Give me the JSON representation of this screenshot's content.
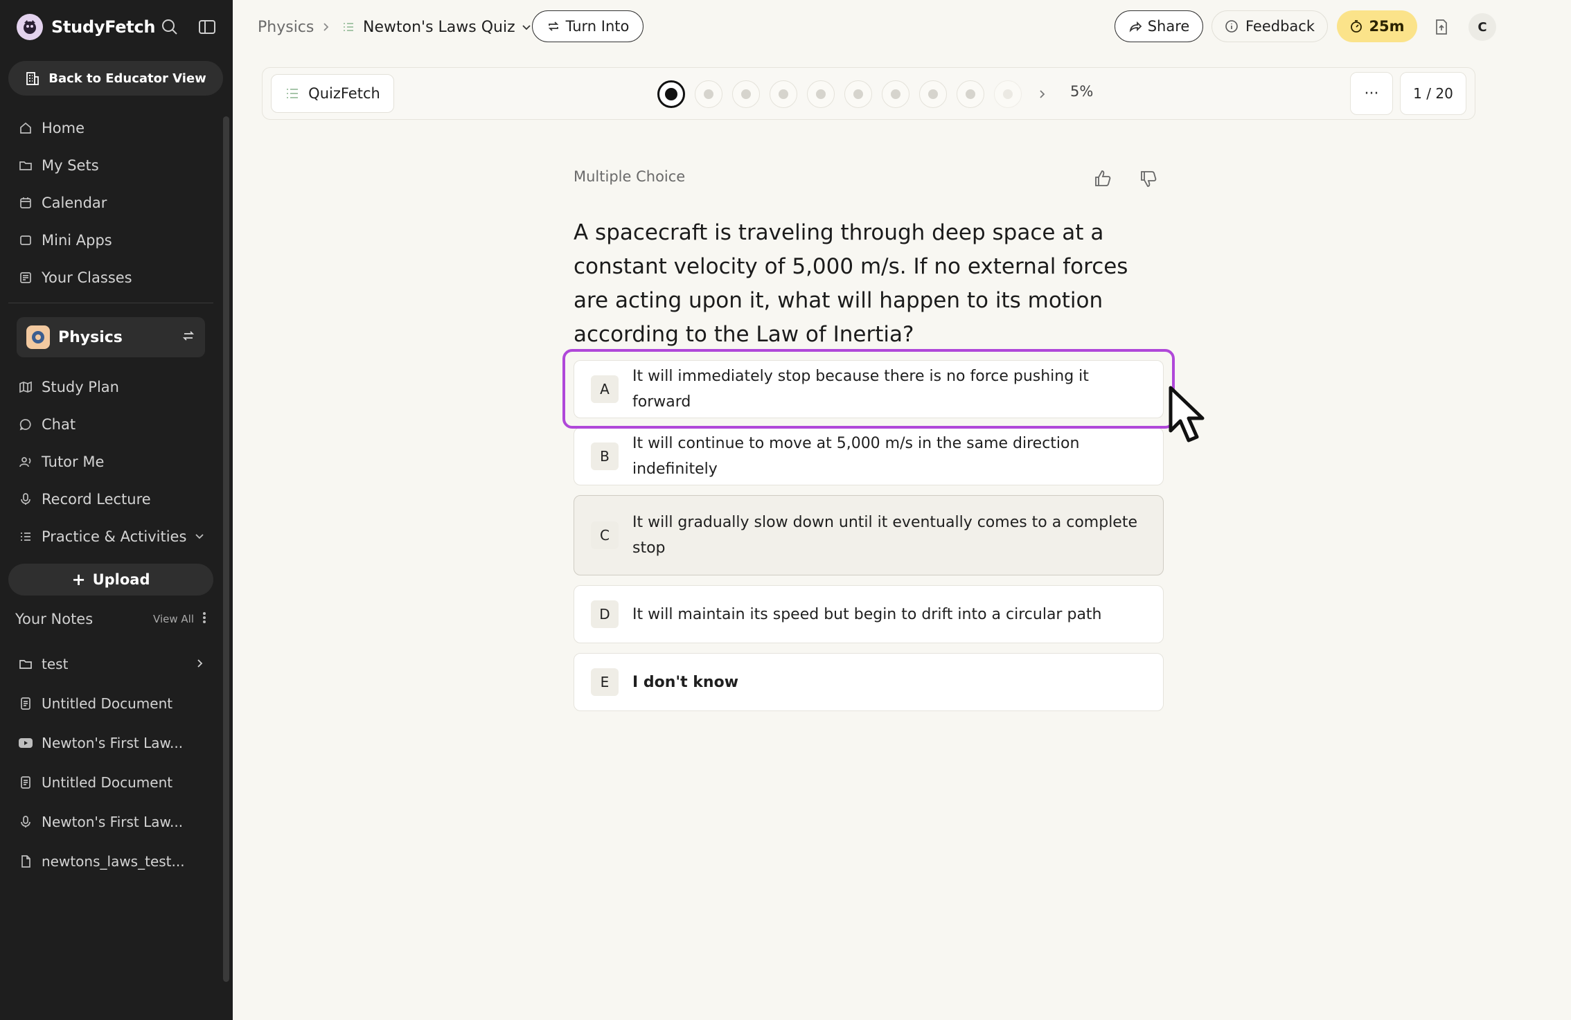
{
  "sidebar": {
    "brand": "StudyFetch",
    "educator_button": "Back to Educator View",
    "nav": [
      {
        "label": "Home",
        "icon": "home-icon"
      },
      {
        "label": "My Sets",
        "icon": "folder-icon"
      },
      {
        "label": "Calendar",
        "icon": "calendar-icon"
      },
      {
        "label": "Mini Apps",
        "icon": "apps-icon"
      },
      {
        "label": "Your Classes",
        "icon": "classes-icon"
      }
    ],
    "subject": {
      "name": "Physics"
    },
    "subject_nav": [
      {
        "label": "Study Plan",
        "icon": "map-icon"
      },
      {
        "label": "Chat",
        "icon": "chat-icon"
      },
      {
        "label": "Tutor Me",
        "icon": "tutor-icon"
      },
      {
        "label": "Record Lecture",
        "icon": "microphone-icon"
      },
      {
        "label": "Practice & Activities",
        "icon": "list-icon"
      }
    ],
    "upload_label": "Upload",
    "notes": {
      "title": "Your Notes",
      "view_all": "View All",
      "items": [
        {
          "label": "test",
          "icon": "folder-icon"
        },
        {
          "label": "Untitled Document",
          "icon": "document-icon"
        },
        {
          "label": "Newton's First Law...",
          "icon": "youtube-icon"
        },
        {
          "label": "Untitled Document",
          "icon": "document-icon"
        },
        {
          "label": "Newton's First Law...",
          "icon": "microphone-icon"
        },
        {
          "label": "newtons_laws_test...",
          "icon": "pdf-icon"
        }
      ]
    }
  },
  "header": {
    "breadcrumb_root": "Physics",
    "breadcrumb_current": "Newton's Laws Quiz",
    "turn_into": "Turn Into",
    "share": "Share",
    "feedback": "Feedback",
    "timer": "25m",
    "avatar_initial": "C"
  },
  "quiz": {
    "tab_label": "QuizFetch",
    "progress_percent": "5%",
    "progress_fraction": 0.05,
    "more": "···",
    "counter": "1 / 20",
    "current_question": 1,
    "total_questions": 20,
    "question_type": "Multiple Choice",
    "question": "A spacecraft is traveling through deep space at a constant velocity of 5,000 m/s. If no external forces are acting upon it, what will happen to its motion according to the Law of Inertia?",
    "options": [
      {
        "letter": "A",
        "text": "It will immediately stop because there is no force pushing it forward"
      },
      {
        "letter": "B",
        "text": "It will continue to move at 5,000 m/s in the same direction indefinitely"
      },
      {
        "letter": "C",
        "text": "It will gradually slow down until it eventually comes to a complete stop"
      },
      {
        "letter": "D",
        "text": "It will maintain its speed but begin to drift into a circular path"
      },
      {
        "letter": "E",
        "text": "I don't know"
      }
    ]
  },
  "colors": {
    "sidebar_bg": "#1e1e1e",
    "page_bg": "#f8f7f2",
    "highlight": "#b048d9",
    "timer_bg": "#fbe38a"
  }
}
